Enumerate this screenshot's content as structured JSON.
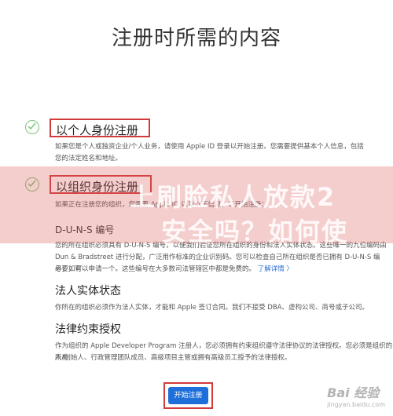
{
  "page": {
    "title": "注册时所需的内容"
  },
  "option_individual": {
    "title": "以个人身份注册",
    "desc_line1": "如果您是个人或独资企业/个人业务，请使用 Apple ID 登录以开始注册。您需要提供基本个人信息，包括",
    "desc_line2": "您的法定姓名和地址。"
  },
  "option_org": {
    "title": "以组织身份注册",
    "intro": "如果正在注册您的组织，您需要 Apple ID 以及以下信息，以开始注册：",
    "duns_label": "D-U-N-S 编号",
    "duns_desc_line1": "您的所在组织必须具有 D-U-N-S 编号，以便我们验证您所在组织的身份和法人实体状态。这些唯一的九位编码由",
    "duns_desc_line2": "Dun & Bradstreet 进行分配，广泛用作标准的企业识别码。您可以检查自己所在组织是否已拥有 D-U-N-S 编号；如有",
    "duns_desc_line3": "必要，可以申请一个。这些编号在大多数司法管辖区中都是免费的。",
    "duns_link": "了解详情 〉"
  },
  "section_entity": {
    "heading": "法人实体状态",
    "desc": "你所在的组织必须作为法人实体，才能和 Apple 签订合同。我们不接受 DBA、虚构公司、商号或子公司。"
  },
  "section_authority": {
    "heading": "法律约束授权",
    "desc_line1": "作为组织的 Apple Developer Program 注册人，您必须拥有约束组织遵守法律协议的法律授权。您必须是组织的所有",
    "desc_line2": "人/创始人、行政管理团队成员、高级项目主管或拥有高级员工授予的法律授权。"
  },
  "overlay": {
    "line1": "上刷脸私人放款2",
    "line2": "安全吗？如何使"
  },
  "start_button": {
    "label": "开始注册"
  },
  "watermark": {
    "brand": "Bai 经验",
    "url": "jingyan.baidu.com"
  },
  "colors": {
    "accent": "#1e6fd9",
    "highlight_border": "#d23b3b",
    "check": "#7cc576"
  }
}
